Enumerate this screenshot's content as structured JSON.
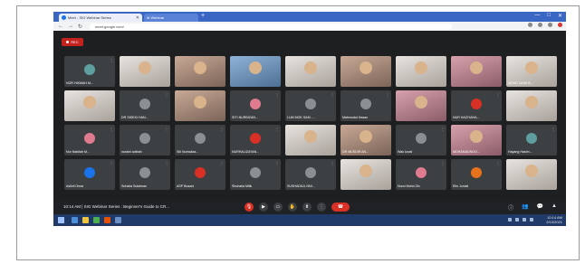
{
  "browser": {
    "tabs": [
      {
        "label": "Meet - SIG Webinar Series",
        "active": true
      },
      {
        "label": "M Webinar",
        "active": false
      }
    ],
    "url": "meet.google.com/",
    "window_controls": [
      "—",
      "□",
      "✕"
    ]
  },
  "meet": {
    "rec_label": "REC",
    "participants": [
      {
        "name": "NOR HIKMAH M...",
        "style": "avatar",
        "color": "teal"
      },
      {
        "name": "",
        "style": "video",
        "tone": "light"
      },
      {
        "name": "",
        "style": "video",
        "tone": "warm"
      },
      {
        "name": "",
        "style": "video",
        "tone": "blue"
      },
      {
        "name": "",
        "style": "video",
        "tone": "light"
      },
      {
        "name": "",
        "style": "video",
        "tone": "warm"
      },
      {
        "name": "",
        "style": "video",
        "tone": "light"
      },
      {
        "name": "",
        "style": "video",
        "tone": "pink"
      },
      {
        "name": "MOHD ZAINI B...",
        "style": "video",
        "tone": "light"
      },
      {
        "name": "",
        "style": "video",
        "tone": "light"
      },
      {
        "name": "DR SIDEKI HAN...",
        "style": "avatar",
        "color": "gray"
      },
      {
        "name": "",
        "style": "video",
        "tone": "warm"
      },
      {
        "name": "SITI NURBIZAN...",
        "style": "avatar",
        "color": "pink"
      },
      {
        "name": "LUM MOK SAM -...",
        "style": "avatar",
        "color": "gray"
      },
      {
        "name": "Mahmudul Hasan",
        "style": "avatar",
        "color": "gray"
      },
      {
        "name": "",
        "style": "video",
        "tone": "pink"
      },
      {
        "name": "NUR HAZIYAHA...",
        "style": "avatar",
        "color": "red"
      },
      {
        "name": "",
        "style": "video",
        "tone": "light"
      },
      {
        "name": "Nur Nabilah M...",
        "style": "avatar",
        "color": "pink"
      },
      {
        "name": "nuraini adibah",
        "style": "avatar",
        "color": "gray"
      },
      {
        "name": "Siti Nurhaliza...",
        "style": "avatar",
        "color": "gray"
      },
      {
        "name": "NURHALIZAYAN...",
        "style": "avatar",
        "color": "red"
      },
      {
        "name": "",
        "style": "video",
        "tone": "light"
      },
      {
        "name": "DR MUSDIR AN...",
        "style": "video",
        "tone": "warm"
      },
      {
        "name": "Wak Izzati",
        "style": "avatar",
        "color": "gray"
      },
      {
        "name": "MOHAMADNOO...",
        "style": "video",
        "tone": "pink"
      },
      {
        "name": "Hayang Hasim...",
        "style": "avatar",
        "color": "teal"
      },
      {
        "name": "Asfizil Omar",
        "style": "avatar",
        "color": "blue"
      },
      {
        "name": "Suhaila Sulaiman",
        "style": "avatar",
        "color": "gray"
      },
      {
        "name": "ASP Busani",
        "style": "avatar",
        "color": "red"
      },
      {
        "name": "Shuhaila Milik",
        "style": "avatar",
        "color": "gray"
      },
      {
        "name": "SUSHADIUL NNI...",
        "style": "avatar",
        "color": "gray"
      },
      {
        "name": "",
        "style": "video",
        "tone": "light"
      },
      {
        "name": "Nurul Mohd Zin",
        "style": "avatar",
        "color": "pink"
      },
      {
        "name": "Elin Juniati",
        "style": "avatar",
        "color": "orange"
      },
      {
        "name": "",
        "style": "video",
        "tone": "light"
      }
    ],
    "meeting_title": "10:14 AM | SIG Webinar Series : Beginner's Guide to CR...",
    "controls": {
      "mic": "🎙",
      "camera": "▶",
      "captions": "▭",
      "raise_hand": "✋",
      "present": "⬆",
      "more": "⋮",
      "end": "☎"
    },
    "right_controls": [
      "ⓘ",
      "👥",
      "💬",
      "▲"
    ]
  },
  "taskbar": {
    "time": "10:14 AM",
    "date": "2/10/2021"
  },
  "colors": {
    "meet_bg": "#1e1f21",
    "tile_bg": "#3c4043",
    "end_red": "#d93025",
    "tab_bar": "#3a66c4",
    "taskbar": "#1f3a68"
  }
}
